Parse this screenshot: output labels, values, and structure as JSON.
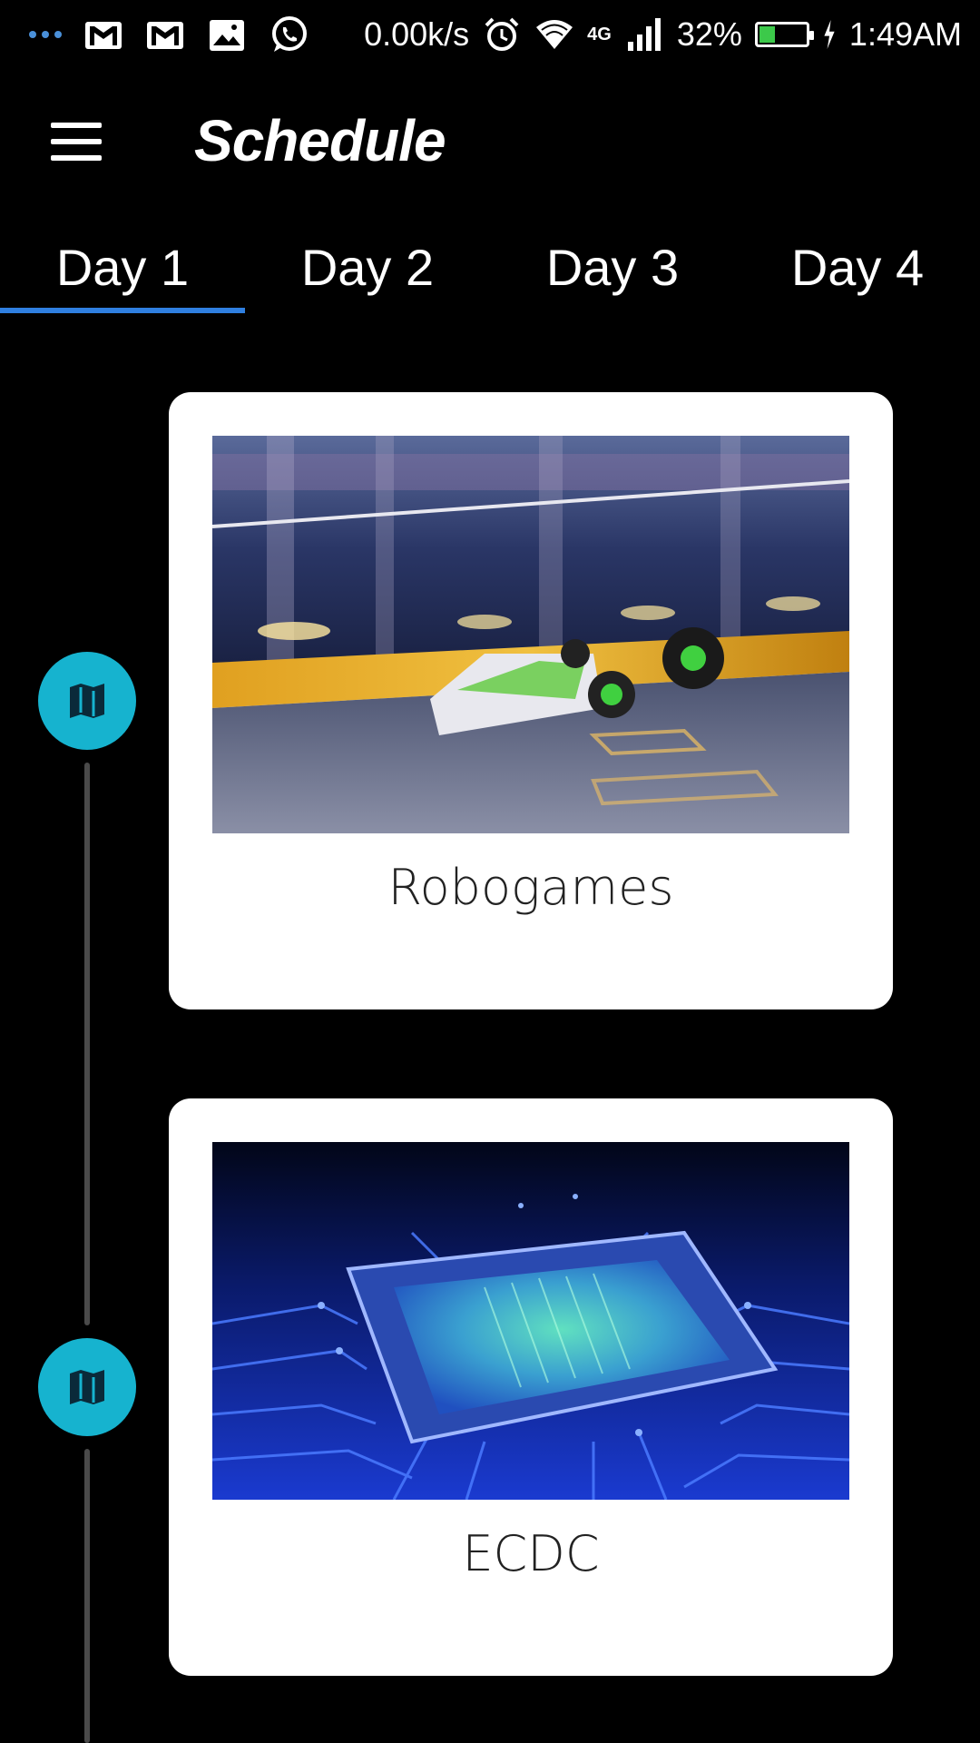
{
  "status_bar": {
    "network_speed": "0.00k/s",
    "network_type": "4G",
    "battery_percent": "32%",
    "battery_level": 0.32,
    "time": "1:49AM",
    "icons": [
      "more-dots-icon",
      "gmail-icon",
      "gmail-icon",
      "gallery-icon",
      "whatsapp-icon",
      "alarm-icon",
      "wifi-icon",
      "signal-icon",
      "battery-icon",
      "charging-icon"
    ]
  },
  "app_bar": {
    "title": "Schedule",
    "menu_icon": "hamburger-menu-icon"
  },
  "tabs": [
    {
      "label": "Day 1",
      "active": true
    },
    {
      "label": "Day 2",
      "active": false
    },
    {
      "label": "Day 3",
      "active": false
    },
    {
      "label": "Day 4",
      "active": false
    }
  ],
  "events": [
    {
      "title": "Robogames",
      "image": "combat-robot-arena-photo",
      "icon": "map-icon"
    },
    {
      "title": "ECDC",
      "image": "circuit-board-chip-photo",
      "icon": "map-icon"
    }
  ],
  "colors": {
    "background": "#000000",
    "accent_tab_indicator": "#2f7fe0",
    "timeline_node": "#16b3cf",
    "card": "#ffffff"
  }
}
